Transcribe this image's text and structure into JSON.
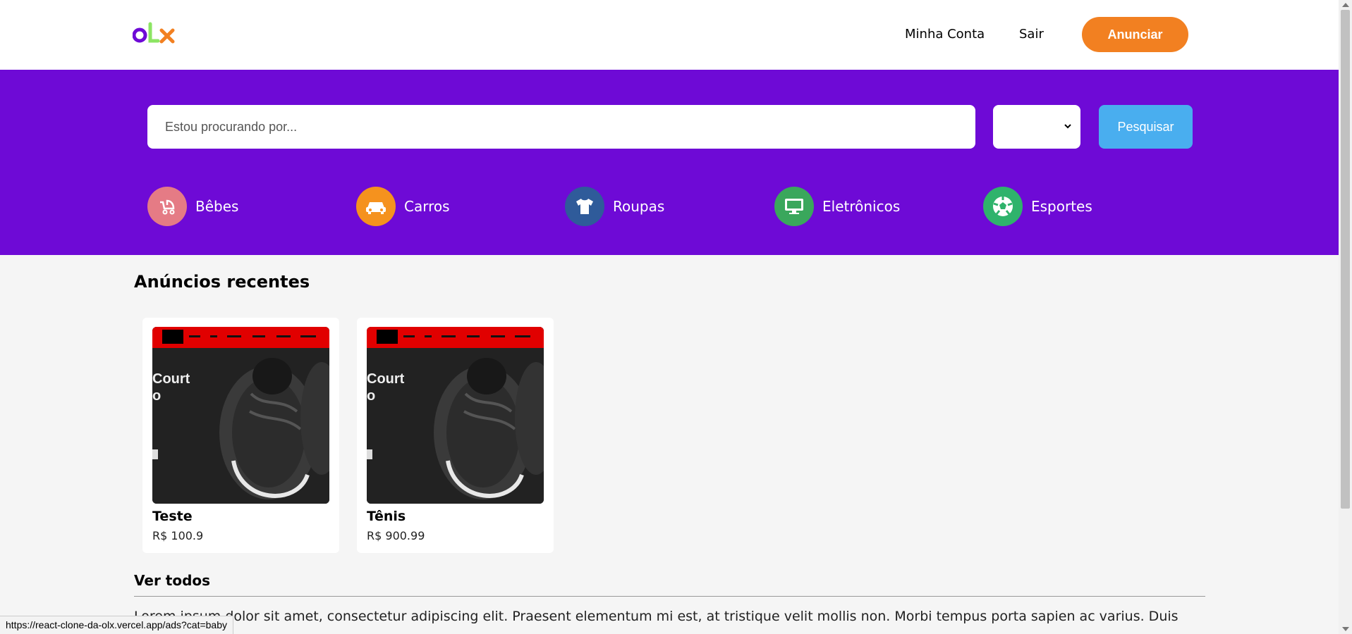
{
  "header": {
    "logo_text": "OLX",
    "nav": {
      "account": "Minha Conta",
      "logout": "Sair"
    },
    "post_button": "Anunciar"
  },
  "search": {
    "placeholder": "Estou procurando por...",
    "state_select_value": "",
    "submit_label": "Pesquisar"
  },
  "categories": [
    {
      "label": "Bêbes",
      "icon": "baby-stroller-icon",
      "color": "#e57b85"
    },
    {
      "label": "Carros",
      "icon": "car-icon",
      "color": "#f5921e"
    },
    {
      "label": "Roupas",
      "icon": "tshirt-icon",
      "color": "#2f5b9a"
    },
    {
      "label": "Eletrônicos",
      "icon": "monitor-icon",
      "color": "#3aa75c"
    },
    {
      "label": "Esportes",
      "icon": "soccer-ball-icon",
      "color": "#2fb36c"
    }
  ],
  "recent": {
    "title": "Anúncios recentes",
    "ads": [
      {
        "name": "Teste",
        "price": "R$ 100.9",
        "image": "sneaker-photo"
      },
      {
        "name": "Tênis",
        "price": "R$ 900.99",
        "image": "sneaker-photo"
      }
    ],
    "see_all": "Ver todos"
  },
  "lorem": "Lorem ipsum dolor sit amet, consectetur adipiscing elit. Praesent elementum mi est, at tristique velit mollis non. Morbi tempus porta sapien ac varius. Duis varius",
  "status_url": "https://react-clone-da-olx.vercel.app/ads?cat=baby",
  "colors": {
    "brand_purple": "#6e0ad6",
    "brand_orange": "#f28021",
    "search_blue": "#49aeef"
  }
}
